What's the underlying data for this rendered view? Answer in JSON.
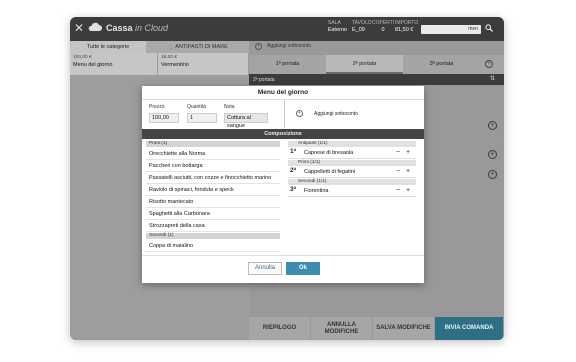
{
  "app": {
    "brand_main": "Cassa",
    "brand_sub": "in Cloud"
  },
  "header": {
    "stats": [
      {
        "label": "SALA",
        "value": "Esterno"
      },
      {
        "label": "TAVOLO",
        "value": "E_09"
      },
      {
        "label": "COPERTI",
        "value": "0"
      },
      {
        "label": "IMPORTO",
        "value": "81,50 €"
      }
    ],
    "search_value": "men"
  },
  "left": {
    "tabs": [
      {
        "label": "Tutte le categorie"
      },
      {
        "label": "ANTIPASTI DI MARE"
      }
    ],
    "cards": [
      {
        "price": "100,00 €",
        "name": "Menu del giorno"
      },
      {
        "price": "16,00 €",
        "name": "Vermentino"
      }
    ]
  },
  "right": {
    "add_note": "Aggiungi sottoconto",
    "portate": [
      {
        "label": "1ª portata"
      },
      {
        "label": "2ª portata"
      },
      {
        "label": "3ª portata"
      }
    ],
    "current_portata": "2ª portata"
  },
  "bottom": {
    "riepilogo": "RIEPILOGO",
    "annulla": "ANNULLA MODIFICHE",
    "salva": "SALVA MODIFICHE",
    "invia": "INVIA COMANDA"
  },
  "modal": {
    "title": "Menu del giorno",
    "prezzo_label": "Prezzo",
    "prezzo_value": "100,00",
    "quantita_label": "Quantità",
    "quantita_value": "1",
    "nota_label": "Nota",
    "nota_value": "Cottura al sangue",
    "add_note": "Aggiungi sottoconto",
    "composizione": "Composizione",
    "list": [
      {
        "type": "cat",
        "text": "Primi (1)"
      },
      {
        "type": "item",
        "text": "Orecchiette alla Norma"
      },
      {
        "type": "item",
        "text": "Paccheri con bottarga"
      },
      {
        "type": "item",
        "text": "Passatelli asciutti, con cozze e finocchietto marino"
      },
      {
        "type": "item",
        "text": "Raviolo di spinaci, fonduta e speck"
      },
      {
        "type": "item",
        "text": "Risotto mantecato"
      },
      {
        "type": "item",
        "text": "Spaghetti alla Carbonara"
      },
      {
        "type": "item",
        "text": "Strozzapreti della casa"
      },
      {
        "type": "cat",
        "text": "Secondi (1)"
      },
      {
        "type": "item",
        "text": "Coppa di maialino"
      }
    ],
    "selected": [
      {
        "cat": "Antipasti (1/1)",
        "num": "1ª",
        "name": "Caprese di bresaola"
      },
      {
        "cat": "Primi (1/1)",
        "num": "2ª",
        "name": "Cappelletti di fegatini"
      },
      {
        "cat": "Secondi (1/1)",
        "num": "3ª",
        "name": "Fiorentina"
      }
    ],
    "annulla": "Annulla",
    "ok": "Ok"
  }
}
